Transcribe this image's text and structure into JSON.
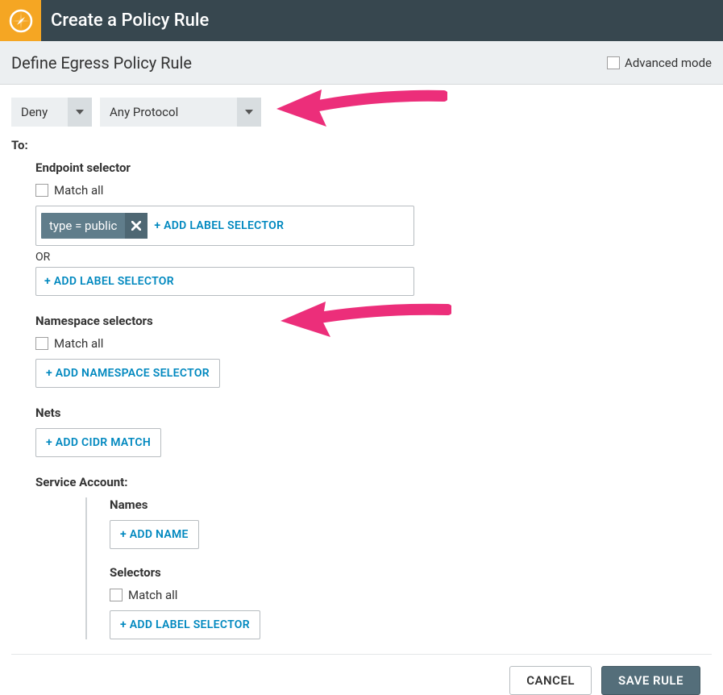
{
  "header": {
    "title": "Create a Policy Rule"
  },
  "subheader": {
    "title": "Define Egress Policy Rule",
    "advanced_label": "Advanced mode"
  },
  "selects": {
    "action": "Deny",
    "protocol": "Any Protocol"
  },
  "labels": {
    "to": "To:",
    "endpoint_selector": "Endpoint selector",
    "match_all": "Match all",
    "add_label_selector": "+ ADD LABEL SELECTOR",
    "or": "OR",
    "namespace_selectors": "Namespace selectors",
    "add_namespace_selector": "+ ADD NAMESPACE SELECTOR",
    "nets": "Nets",
    "add_cidr": "+ ADD CIDR MATCH",
    "service_account": "Service Account:",
    "names": "Names",
    "add_name": "+ ADD NAME",
    "selectors": "Selectors"
  },
  "chips": {
    "endpoint_label": "type = public"
  },
  "footer": {
    "cancel": "CANCEL",
    "save": "SAVE RULE"
  },
  "colors": {
    "accent": "#0088bf",
    "brand": "#f5a623",
    "header": "#37474f",
    "chip": "#607d8b",
    "save": "#546e7a",
    "annotation": "#ec2e7a"
  }
}
